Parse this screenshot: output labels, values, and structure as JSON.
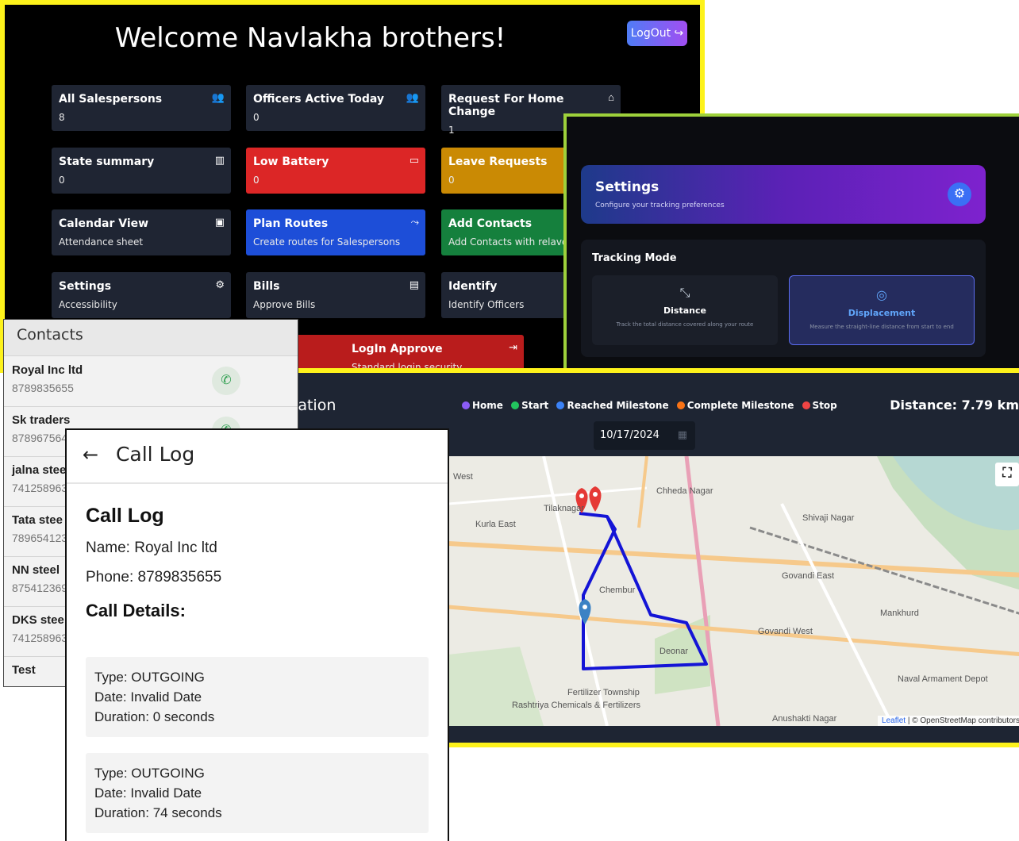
{
  "dashboard": {
    "welcome": "Welcome Navlakha brothers!",
    "logout_label": "LogOut",
    "cards": [
      {
        "title": "All Salespersons",
        "sub": "8"
      },
      {
        "title": "Officers Active Today",
        "sub": "0"
      },
      {
        "title": "Request For Home Change",
        "sub": "1"
      },
      {
        "title": "State summary",
        "sub": "0"
      },
      {
        "title": "Low Battery",
        "sub": "0"
      },
      {
        "title": "Leave Requests",
        "sub": "0"
      },
      {
        "title": "Calendar View",
        "sub": "Attendance sheet"
      },
      {
        "title": "Plan Routes",
        "sub": "Create routes for Salespersons"
      },
      {
        "title": "Add Contacts",
        "sub": "Add Contacts with relavent"
      },
      {
        "title": "Settings",
        "sub": "Accessibility"
      },
      {
        "title": "Bills",
        "sub": "Approve Bills"
      },
      {
        "title": "Identify",
        "sub": "Identify Officers"
      },
      {
        "title": "LogIn Approve",
        "sub": "Standard login security"
      }
    ],
    "colors": {
      "border": "#fdf21b",
      "red": "#dc2626",
      "amber": "#ca8a04",
      "blue": "#1d4ed8",
      "green": "#15803d"
    }
  },
  "settings": {
    "title": "Settings",
    "subtitle": "Configure your tracking preferences",
    "tracking_mode_label": "Tracking Mode",
    "modes": [
      {
        "label": "Distance",
        "desc": "Track the total distance covered along your route",
        "active": false
      },
      {
        "label": "Displacement",
        "desc": "Measure the straight-line distance from start to end",
        "active": true
      }
    ]
  },
  "contacts": {
    "title": "Contacts",
    "items": [
      {
        "name": "Royal Inc ltd",
        "phone": "8789835655"
      },
      {
        "name": "Sk traders",
        "phone": "878967564"
      },
      {
        "name": "jalna stee",
        "phone": "741258963"
      },
      {
        "name": "Tata stee",
        "phone": "789654123"
      },
      {
        "name": "NN steel",
        "phone": "875412369"
      },
      {
        "name": "DKS stee",
        "phone": "741258963"
      },
      {
        "name": "Test",
        "phone": ""
      }
    ]
  },
  "call_log": {
    "bar_title": "Call Log",
    "heading": "Call Log",
    "name_line": "Name: Royal Inc ltd",
    "phone_line": "Phone: 8789835655",
    "details_heading": "Call Details:",
    "entries": [
      {
        "type": "Type: OUTGOING",
        "date": "Date: Invalid Date",
        "duration": "Duration: 0 seconds"
      },
      {
        "type": "Type: OUTGOING",
        "date": "Date: Invalid Date",
        "duration": "Duration: 74 seconds"
      }
    ]
  },
  "location": {
    "title": "Location",
    "legend": [
      {
        "label": "Home",
        "color": "#8b5cf6"
      },
      {
        "label": "Start",
        "color": "#22c55e"
      },
      {
        "label": "Reached Milestone",
        "color": "#3b82f6"
      },
      {
        "label": "Complete Milestone",
        "color": "#f97316"
      },
      {
        "label": "Stop",
        "color": "#ef4444"
      }
    ],
    "distance": "Distance: 7.79 km",
    "date": "10/17/2024",
    "map_labels": [
      "Chheda Nagar",
      "Shivaji Nagar",
      "Kurla East",
      "Govandi East",
      "Govandi West",
      "Chembur",
      "Mankhurd",
      "Deonar",
      "Anushakti Nagar",
      "Tilaknagar",
      "Fertilizer Township",
      "Rashtriya Chemicals & Fertilizers",
      "Naval Armament Depot",
      "West"
    ],
    "attribution_leaflet": "Leaflet",
    "attribution_rest": "| © OpenStreetMap contributors",
    "route_color": "#1414d6"
  }
}
